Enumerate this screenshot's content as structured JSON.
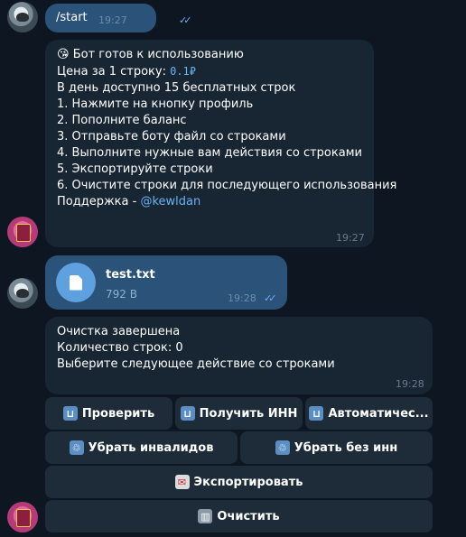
{
  "messages": {
    "start": {
      "text": "/start",
      "time": "19:27"
    },
    "welcome": {
      "emoji": "😘",
      "lines": [
        "Бот готов к использованию",
        "Цена за 1 строку: ",
        "В день доступно 15 бесплатных строк",
        "",
        "1. Нажмите на кнопку профиль",
        "2. Пополните баланс",
        "3. Отправьте боту файл со строками",
        "4. Выполните нужные вам действия со строками",
        "5. Экспортируйте строки",
        "6. Очистите строки для последующего использования",
        "",
        "Поддержка - "
      ],
      "price": "0.1₽",
      "support_link": "@kewldan",
      "time": "19:27"
    },
    "file": {
      "name": "test.txt",
      "size": "792 B",
      "time": "19:28"
    },
    "cleanup": {
      "lines": [
        "Очистка завершена",
        "",
        "Количество строк: 0",
        "Выберите следующее действие со строками"
      ],
      "time": "19:28"
    }
  },
  "keyboard": {
    "check": "Проверить",
    "get_inn": "Получить ИНН",
    "auto": "Автоматичес...",
    "remove_invalid": "Убрать инвалидов",
    "remove_no_inn": "Убрать без инн",
    "export": "Экспортировать",
    "clear": "Очистить"
  },
  "colors": {
    "background": "#0e1621",
    "outgoing": "#2b5278",
    "incoming": "#182533",
    "link": "#6ab3f3"
  }
}
